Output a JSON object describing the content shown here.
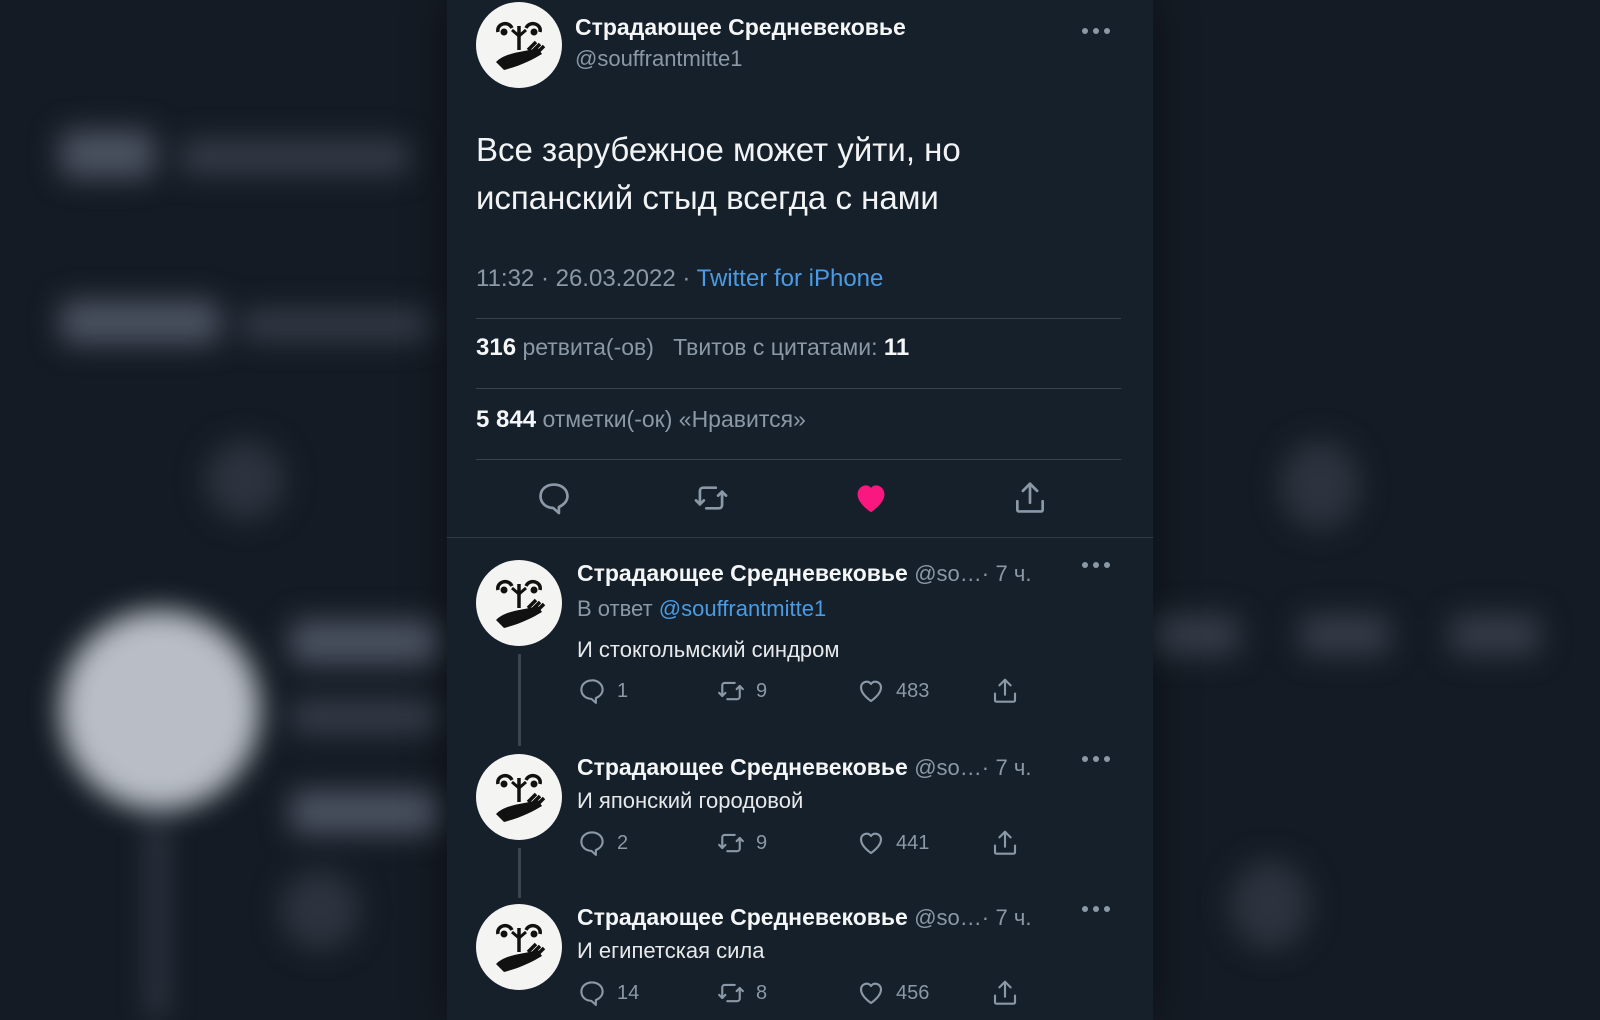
{
  "colors": {
    "background": "#151b24",
    "card": "#15202b",
    "text": "#e7e9ea",
    "muted": "#8b98a5",
    "link": "#4a9be4",
    "like_active": "#f91880",
    "divider": "#38444d"
  },
  "icons": {
    "more": "more-dots-icon",
    "reply": "speech-bubble-icon",
    "retweet": "retweet-arrows-icon",
    "like": "heart-icon",
    "share": "share-upload-icon"
  },
  "tweet": {
    "author_name": "Страдающее Средневековье",
    "author_handle": "@souffrantmitte1",
    "text": "Все зарубежное может уйти, но испанский стыд всегда с нами",
    "time": "11:32 · 26.03.2022 · ",
    "source": "Twitter for iPhone",
    "retweets_count": "316",
    "retweets_label": "ретвита(-ов)",
    "quotes_label": "Твитов с цитатами:",
    "quotes_count": "11",
    "likes_count": "5 844",
    "likes_label": "отметки(-ок) «Нравится»",
    "liked": true
  },
  "replies": [
    {
      "author_name": "Страдающее Средневековье",
      "author_handle": "@so…",
      "separator": "·",
      "time": "7 ч.",
      "reply_to_label": "В ответ",
      "reply_to_handle": "@souffrantmitte1",
      "text": "И стокгольмский синдром",
      "reply_count": "1",
      "retweet_count": "9",
      "like_count": "483"
    },
    {
      "author_name": "Страдающее Средневековье",
      "author_handle": "@so…",
      "separator": "·",
      "time": "7 ч.",
      "text": "И японский городовой",
      "reply_count": "2",
      "retweet_count": "9",
      "like_count": "441"
    },
    {
      "author_name": "Страдающее Средневековье",
      "author_handle": "@so…",
      "separator": "·",
      "time": "7 ч.",
      "text": "И египетская сила",
      "reply_count": "14",
      "retweet_count": "8",
      "like_count": "456"
    }
  ]
}
